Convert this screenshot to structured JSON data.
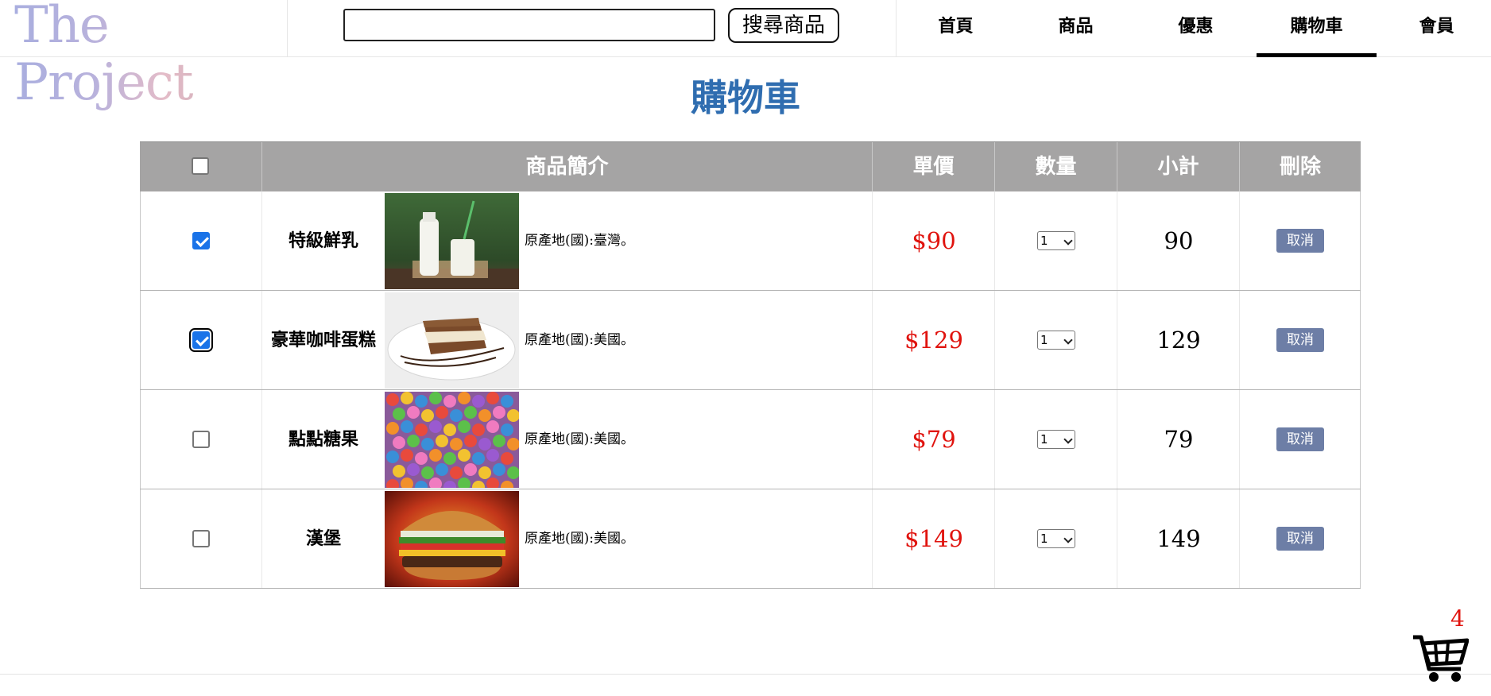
{
  "header": {
    "logo_text": "The Project",
    "search": {
      "value": "",
      "placeholder": ""
    },
    "search_button": "搜尋商品",
    "nav": [
      {
        "label": "首頁"
      },
      {
        "label": "商品"
      },
      {
        "label": "優惠"
      },
      {
        "label": "購物車",
        "active": true
      },
      {
        "label": "會員"
      }
    ]
  },
  "page": {
    "title": "購物車"
  },
  "table": {
    "headers": {
      "select_all": "",
      "description": "商品簡介",
      "unit_price": "單價",
      "quantity": "數量",
      "subtotal": "小計",
      "delete": "刪除"
    },
    "rows": [
      {
        "checked": true,
        "name": "特級鮮乳",
        "image_icon": "milk-bottles-photo",
        "origin": "原產地(國):臺灣。",
        "price": "$90",
        "qty": "1",
        "subtotal": "90",
        "cancel": "取消"
      },
      {
        "checked": true,
        "name": "豪華咖啡蛋糕",
        "image_icon": "coffee-cake-photo",
        "origin": "原產地(國):美國。",
        "price": "$129",
        "qty": "1",
        "subtotal": "129",
        "cancel": "取消"
      },
      {
        "checked": false,
        "name": "點點糖果",
        "image_icon": "candy-photo",
        "origin": "原產地(國):美國。",
        "price": "$79",
        "qty": "1",
        "subtotal": "79",
        "cancel": "取消"
      },
      {
        "checked": false,
        "name": "漢堡",
        "image_icon": "burger-photo",
        "origin": "原產地(國):美國。",
        "price": "$149",
        "qty": "1",
        "subtotal": "149",
        "cancel": "取消"
      }
    ]
  },
  "cart_badge": {
    "count": "4",
    "icon": "shopping-cart-icon"
  },
  "colors": {
    "title": "#2f6db0",
    "price": "#e0130e",
    "header_bg": "#a5a4a4",
    "cancel_bg": "#6d7ea6",
    "checkbox": "#1a73e8"
  }
}
